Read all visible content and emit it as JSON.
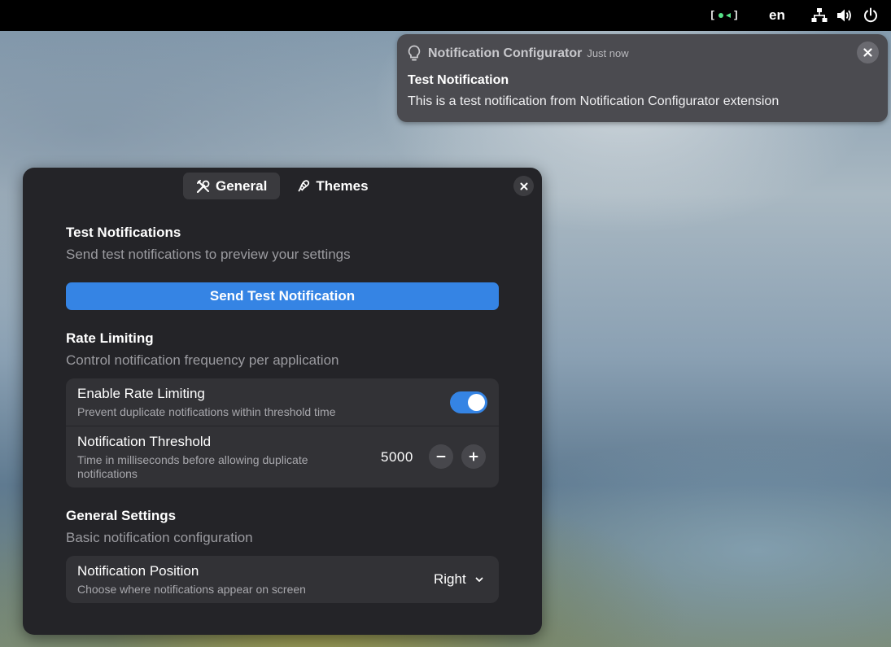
{
  "topbar": {
    "language": "en",
    "indicator_icon": "screencast-indicator-icon",
    "icons": [
      "network-icon",
      "volume-icon",
      "power-icon"
    ]
  },
  "notification": {
    "app_name": "Notification Configurator",
    "time": "Just now",
    "title": "Test Notification",
    "body": "This is a test notification from Notification Configurator extension",
    "icon": "lightbulb-icon"
  },
  "window": {
    "tabs": [
      {
        "label": "General",
        "icon": "tools-icon",
        "active": true
      },
      {
        "label": "Themes",
        "icon": "palette-icon",
        "active": false
      }
    ],
    "sections": {
      "test": {
        "title": "Test Notifications",
        "subtitle": "Send test notifications to preview your settings",
        "button_label": "Send Test Notification"
      },
      "rate": {
        "title": "Rate Limiting",
        "subtitle": "Control notification frequency per application",
        "enable": {
          "title": "Enable Rate Limiting",
          "subtitle": "Prevent duplicate notifications within threshold time",
          "enabled": true
        },
        "threshold": {
          "title": "Notification Threshold",
          "subtitle_line1": "Time in milliseconds before allowing duplicate",
          "subtitle_line2": "notifications",
          "value": "5000"
        }
      },
      "general": {
        "title": "General Settings",
        "subtitle": "Basic notification configuration",
        "position": {
          "title": "Notification Position",
          "subtitle": "Choose where notifications appear on screen",
          "value": "Right"
        }
      }
    }
  },
  "colors": {
    "accent": "#3584e4",
    "window_bg": "#242428",
    "card_bg": "#323236",
    "indicator_green": "#57e389"
  }
}
